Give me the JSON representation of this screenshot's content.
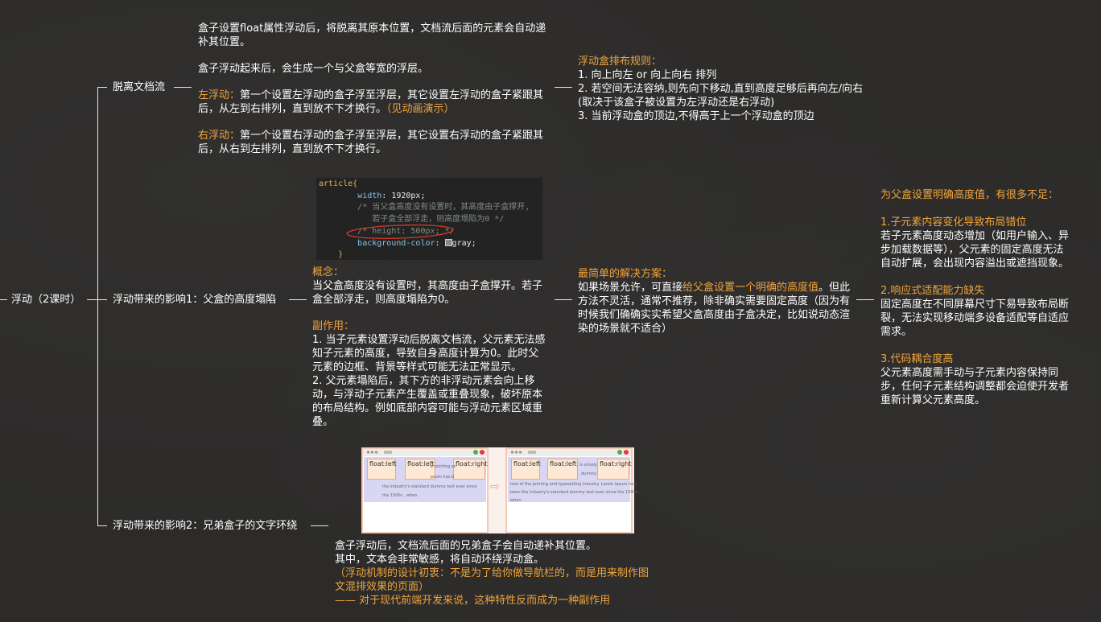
{
  "root": {
    "label": "浮动（2课时）"
  },
  "branches": [
    {
      "label": "脱离文档流"
    },
    {
      "label": "浮动带来的影响1：父盒的高度塌陷"
    },
    {
      "label": "浮动带来的影响2：兄弟盒子的文字环绕"
    }
  ],
  "detach": {
    "p1": "盒子设置float属性浮动后，将脱离其原本位置，文档流后面的元素会自动递补其位置。",
    "p2": "盒子浮动起来后，会生成一个与父盒等宽的浮层。",
    "left_label": "左浮动：",
    "left_text": "第一个设置左浮动的盒子浮至浮层，其它设置左浮动的盒子紧跟其后，从左到右排列，直到放不下才换行。",
    "left_link": "（见动画演示）",
    "right_label": "右浮动：",
    "right_text": "第一个设置右浮动的盒子浮至浮层，其它设置右浮动的盒子紧跟其后，从右到左排列，直到放不下才换行。"
  },
  "rules": {
    "title": "浮动盒排布规则：",
    "r1": "1. 向上向左 or 向上向右 排列",
    "r2": "2. 若空间无法容纳,则先向下移动,直到高度足够后再向左/向右",
    "r3": "(取决于该盒子被设置为左浮动还是右浮动)",
    "r4": "3. 当前浮动盒的顶边,不得高于上一个浮动盒的顶边"
  },
  "code": {
    "l1": "article{",
    "l2_prop": "width",
    "l2_val": ": 1920px;",
    "l3": "/* 当父盒高度没有设置时，其高度由子盒撑开,",
    "l4": "若子盒全部浮走，则高度塌陷为0 */",
    "l5": "/* height: 500px; */",
    "l6_prop": "background-color",
    "l6_val": ": ",
    "l6_val2": "gray;",
    "l7": "}"
  },
  "collapse": {
    "concept_label": "概念：",
    "concept_text": "当父盒高度没有设置时，其高度由子盒撑开。若子盒全部浮走，则高度塌陷为0。",
    "side_label": "副作用：",
    "side_1": "1. 当子元素设置浮动后脱离文档流，父元素无法感知子元素的高度，导致自身高度计算为0。此时父元素的边框、背景等样式可能无法正常显示。",
    "side_2": "2. 父元素塌陷后，其下方的非浮动元素会向上移动，与浮动子元素产生覆盖或重叠现象，破坏原本的布局结构。例如底部内容可能与浮动元素区域重叠。"
  },
  "solution": {
    "title": "最简单的解决方案：",
    "text_a": "如果场景允许，可直接",
    "text_hl": "给父盒设置一个明确的高度值",
    "text_b": "。但此方法不灵活，通常不推荐，除非确实需要固定高度（因为有时候我们确确实实希望父盒高度由子盒决定，比如说动态渲染的场景就不适合）"
  },
  "drawbacks": {
    "title": "为父盒设置明确高度值，有很多不足：",
    "d1_title": "1.子元素内容变化导致布局错位",
    "d1_text": "若子元素高度动态增加（如用户输入、异步加载数据等），父元素的固定高度无法自动扩展，会出现内容溢出或遮挡现象。",
    "d2_title": "2.响应式适配能力缺失",
    "d2_text": "固定高度在不同屏幕尺寸下易导致布局断裂，无法实现移动端多设备适配等自适应需求。",
    "d3_title": "3.代码耦合度高",
    "d3_text": "父元素高度需手动与子元素内容保持同步，任何子元素结构调整都会迫使开发者重新计算父元素高度。"
  },
  "demo": {
    "box1": "float:left",
    "box2": "float:left",
    "box3": "float:right",
    "before_t1": "e printing an",
    "before_t2": "psum has b",
    "before_t3": "the industry's standard dummy text ever since",
    "before_t4": "the 1500s , when",
    "after_t1": "is simply",
    "after_t2": "dummy",
    "after_t3": "text  of  the  printing  and   typesetting industry.   Lorem  Ipsum has",
    "after_t4": "been  the industry's standard  dummy text ever  since  the 1500s ,",
    "after_t5": "when",
    "arrow": "⇨"
  },
  "wrap": {
    "l1": "盒子浮动后，文档流后面的兄弟盒子会自动递补其位置。",
    "l2": "其中，文本会非常敏感，将自动环绕浮动盒。",
    "l3": "（浮动机制的设计初衷：不是为了给你做导航栏的，而是用来制作图文混排效果的页面）",
    "l4": "—— 对于现代前端开发来说，这种特性反而成为一种副作用"
  }
}
